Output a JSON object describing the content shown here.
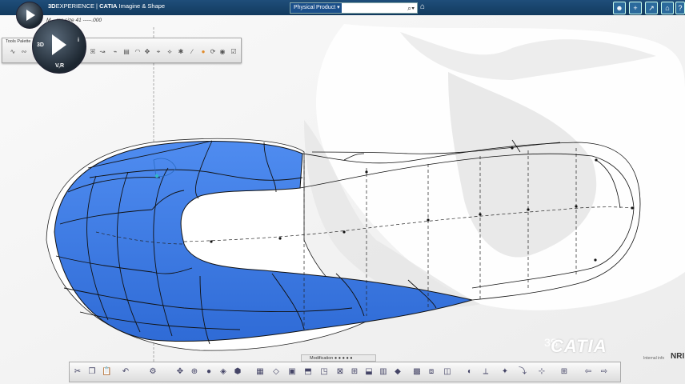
{
  "app": {
    "brand_prefix": "3D",
    "brand_experience": "EXPERIENCE",
    "brand_sep": "|",
    "brand_catia": "CATIA",
    "brand_app": "Imagine & Shape",
    "search_scope": "Physical Product",
    "tab_title": "M... ms size 41 -----.000"
  },
  "compass": {
    "label_3d": "3D",
    "label_vr": "V,R",
    "label_i": "i"
  },
  "tools_palette": {
    "title": "Tools Palette"
  },
  "bottom": {
    "section_label": "Modification",
    "watermark": "CATIA",
    "watermark_ds": "3S",
    "corner_text": "NRI",
    "tiny_text": "Internal info"
  },
  "icons": {
    "top_right": [
      "user-icon",
      "add-icon",
      "share-icon",
      "forward-icon",
      "home-icon",
      "help-icon"
    ],
    "palette": [
      "curve-icon",
      "curve-2-icon",
      "draw-icon",
      "sweep-icon",
      "lasso-icon",
      "snap-icon",
      "layers-icon",
      "doc-icon",
      "arc-icon",
      "move-icon",
      "rotate-icon",
      "gear-icon",
      "line-icon",
      "mirror-icon",
      "eye-icon",
      "checkbox-icon"
    ],
    "toolbar": [
      "cut-icon",
      "copy-icon",
      "paste-icon",
      "undo-icon",
      "select-icon",
      "move-icon",
      "zoom-icon",
      "sphere-icon",
      "cube-icon",
      "box-icon",
      "shape-icon",
      "surface-icon",
      "edit-icon",
      "extrude-icon",
      "drag-icon",
      "delete-icon",
      "subdivide-icon",
      "loft-icon",
      "shell-icon",
      "blend-icon",
      "grid-icon",
      "box3d-icon",
      "view-icon",
      "compass-icon",
      "axis-icon",
      "magnet-icon",
      "xyz-icon",
      "grid2-icon",
      "back-icon",
      "forward-icon"
    ]
  },
  "colors": {
    "topbar": "#1a4a74",
    "sole_blue": "#3f7fe0",
    "wire": "#111111"
  }
}
